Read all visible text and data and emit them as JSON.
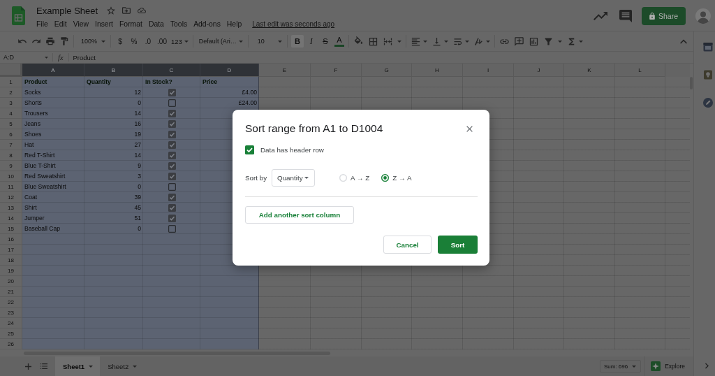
{
  "title_bar": {
    "doc_title": "Example Sheet",
    "menu": [
      "File",
      "Edit",
      "View",
      "Insert",
      "Format",
      "Data",
      "Tools",
      "Add-ons",
      "Help"
    ],
    "last_edit": "Last edit was seconds ago",
    "share_button": "Share"
  },
  "toolbar": {
    "zoom": "100%",
    "currency": "$",
    "percent": "%",
    "decimal_decrease": ".0",
    "decimal_increase": ".00",
    "number_format": "123",
    "font": "Default (Ari…",
    "font_size": "10",
    "bold": {
      "label": "B",
      "selected": true
    },
    "italic": "I",
    "strikethrough": "S",
    "text_color": "A"
  },
  "formula_bar": {
    "name_box": "A:D",
    "fx": "fx",
    "value": "Product"
  },
  "sheet": {
    "columns": [
      {
        "label": "A",
        "selected": true
      },
      {
        "label": "B",
        "selected": true
      },
      {
        "label": "C",
        "selected": true
      },
      {
        "label": "D",
        "selected": true
      },
      {
        "label": "E",
        "selected": false
      },
      {
        "label": "F",
        "selected": false
      },
      {
        "label": "G",
        "selected": false
      },
      {
        "label": "H",
        "selected": false
      },
      {
        "label": "I",
        "selected": false
      },
      {
        "label": "J",
        "selected": false
      },
      {
        "label": "K",
        "selected": false
      },
      {
        "label": "L",
        "selected": false
      }
    ],
    "header_row": {
      "number": "1",
      "titles": [
        "Product",
        "Quantity",
        "In Stock?",
        "Price"
      ]
    },
    "rows": [
      {
        "number": "2",
        "product": "Socks",
        "quantity": "12",
        "in_stock": true,
        "price": "£4.00"
      },
      {
        "number": "3",
        "product": "Shorts",
        "quantity": "0",
        "in_stock": false,
        "price": "£24.00"
      },
      {
        "number": "4",
        "product": "Trousers",
        "quantity": "14",
        "in_stock": true
      },
      {
        "number": "5",
        "product": "Jeans",
        "quantity": "16",
        "in_stock": true
      },
      {
        "number": "6",
        "product": "Shoes",
        "quantity": "19",
        "in_stock": true
      },
      {
        "number": "7",
        "product": "Hat",
        "quantity": "27",
        "in_stock": true
      },
      {
        "number": "8",
        "product": "Red T-Shirt",
        "quantity": "14",
        "in_stock": true
      },
      {
        "number": "9",
        "product": "Blue T-Shirt",
        "quantity": "9",
        "in_stock": true
      },
      {
        "number": "10",
        "product": "Red Sweatshirt",
        "quantity": "3",
        "in_stock": true
      },
      {
        "number": "11",
        "product": "Blue Sweatshirt",
        "quantity": "0",
        "in_stock": false
      },
      {
        "number": "12",
        "product": "Coat",
        "quantity": "39",
        "in_stock": true
      },
      {
        "number": "13",
        "product": "Shirt",
        "quantity": "45",
        "in_stock": true
      },
      {
        "number": "14",
        "product": "Jumper",
        "quantity": "51",
        "in_stock": true
      },
      {
        "number": "15",
        "product": "Baseball Cap",
        "quantity": "0",
        "in_stock": false
      }
    ],
    "empty_rows": [
      "16",
      "17",
      "18",
      "19",
      "20",
      "21",
      "22",
      "23",
      "24",
      "25",
      "26"
    ]
  },
  "sheet_tabs": [
    {
      "label": "Sheet1",
      "selected": true
    },
    {
      "label": "Sheet2",
      "selected": false
    }
  ],
  "status": {
    "sum": "Sum: 696",
    "explore": "Explore"
  },
  "dialog": {
    "title": "Sort range from A1 to D1004",
    "header_row": {
      "label": "Data has header row",
      "checked": true
    },
    "sort_by_label": "Sort by",
    "sort_column": "Quantity",
    "order_options": [
      {
        "label": "A → Z",
        "selected": false
      },
      {
        "label": "Z → A",
        "selected": true
      }
    ],
    "add_column_button": "Add another sort column",
    "buttons": [
      {
        "label": "Cancel",
        "kind": "secondary"
      },
      {
        "label": "Sort",
        "kind": "primary"
      }
    ]
  }
}
